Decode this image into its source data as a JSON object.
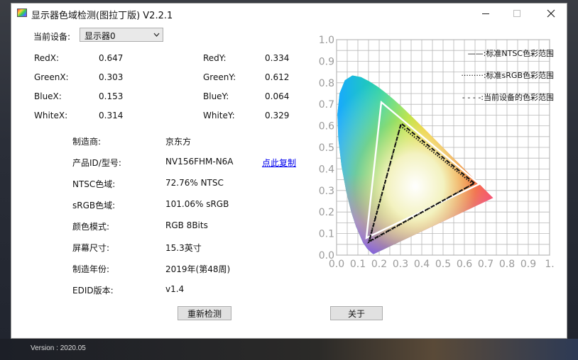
{
  "window": {
    "title": "显示器色域检测(图拉丁版) V2.2.1"
  },
  "device_select": {
    "label": "当前设备:",
    "value": "显示器0"
  },
  "coords": {
    "red_x_label": "RedX:",
    "red_x": "0.647",
    "red_y_label": "RedY:",
    "red_y": "0.334",
    "green_x_label": "GreenX:",
    "green_x": "0.303",
    "green_y_label": "GreenY:",
    "green_y": "0.612",
    "blue_x_label": "BlueX:",
    "blue_x": "0.153",
    "blue_y_label": "BlueY:",
    "blue_y": "0.064",
    "white_x_label": "WhiteX:",
    "white_x": "0.314",
    "white_y_label": "WhiteY:",
    "white_y": "0.329"
  },
  "info": [
    {
      "label": "制造商:",
      "value": "京东方"
    },
    {
      "label": "产品ID/型号:",
      "value": "NV156FHM-N6A"
    },
    {
      "label": "NTSC色域:",
      "value": "72.76% NTSC"
    },
    {
      "label": "sRGB色域:",
      "value": "101.06% sRGB"
    },
    {
      "label": "颜色模式:",
      "value": "RGB 8Bits"
    },
    {
      "label": "屏幕尺寸:",
      "value": "15.3英寸"
    },
    {
      "label": "制造年份:",
      "value": "2019年(第48周)"
    },
    {
      "label": "EDID版本:",
      "value": "v1.4"
    }
  ],
  "copy_link": "点此复制",
  "buttons": {
    "redetect": "重新检测",
    "about": "关于"
  },
  "footer": {
    "version": "Version : 2020.05"
  },
  "chart_data": {
    "type": "scatter",
    "title": "",
    "xlabel": "",
    "ylabel": "",
    "xlim": [
      0,
      1.0
    ],
    "ylim": [
      0,
      1.0
    ],
    "x_ticks": [
      "0.0",
      "0.1",
      "0.2",
      "0.3",
      "0.4",
      "0.5",
      "0.6",
      "0.7",
      "0.8",
      "0.9",
      "1."
    ],
    "y_ticks": [
      "0.0",
      "0.1",
      "0.2",
      "0.3",
      "0.4",
      "0.5",
      "0.6",
      "0.7",
      "0.8",
      "0.9",
      "1.0"
    ],
    "grid": true,
    "legend_position": "top-right",
    "series": [
      {
        "name": "标准NTSC色彩范围",
        "style": "solid",
        "color": "#ffffff",
        "points": [
          [
            0.67,
            0.33
          ],
          [
            0.21,
            0.71
          ],
          [
            0.14,
            0.08
          ]
        ]
      },
      {
        "name": "标准sRGB色彩范围",
        "style": "dotted",
        "color": "#111111",
        "points": [
          [
            0.64,
            0.33
          ],
          [
            0.3,
            0.6
          ],
          [
            0.15,
            0.06
          ]
        ]
      },
      {
        "name": "当前设备的色彩范围",
        "style": "dashed",
        "color": "#111111",
        "points": [
          [
            0.647,
            0.334
          ],
          [
            0.303,
            0.612
          ],
          [
            0.153,
            0.064
          ]
        ]
      }
    ],
    "legend_entries": [
      "——:标准NTSC色彩范围",
      "·········:标准sRGB色彩范围",
      "- - - -:当前设备的色彩范围"
    ]
  }
}
